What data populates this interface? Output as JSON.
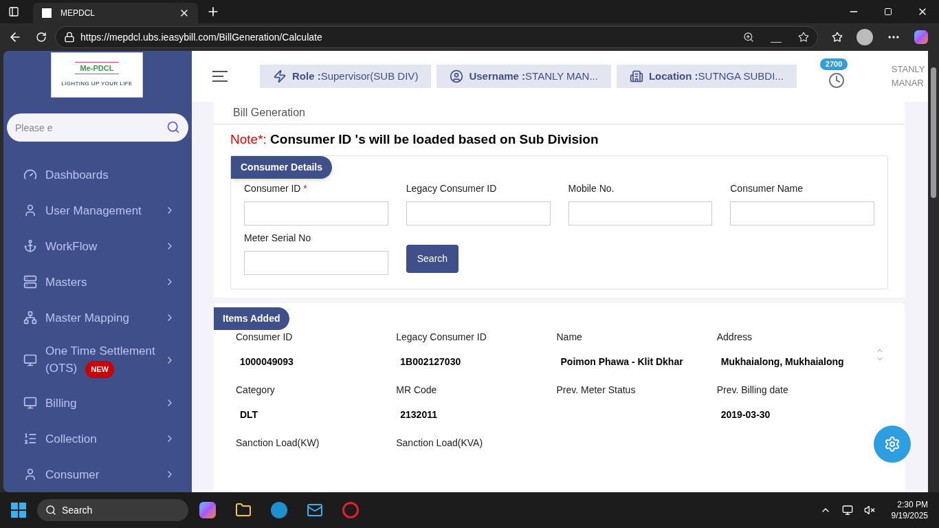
{
  "browser": {
    "tab_title": "MEPDCL",
    "url": "https://mepdcl.ubs.ieasybill.com/BillGeneration/Calculate"
  },
  "logo": {
    "name": "Me-PDCL",
    "tagline": "LIGHTING UP YOUR LIFE"
  },
  "sidebar": {
    "search_placeholder": "Please e",
    "items": [
      {
        "label": "Dashboards",
        "expandable": false
      },
      {
        "label": "User Management",
        "expandable": true
      },
      {
        "label": "WorkFlow",
        "expandable": true
      },
      {
        "label": "Masters",
        "expandable": true
      },
      {
        "label": "Master Mapping",
        "expandable": true
      },
      {
        "label": "One Time Settlement (OTS)",
        "expandable": true,
        "badge": "NEW"
      },
      {
        "label": "Billing",
        "expandable": true
      },
      {
        "label": "Collection",
        "expandable": true
      },
      {
        "label": "Consumer",
        "expandable": true
      }
    ]
  },
  "header": {
    "chips": [
      {
        "label": "Role :",
        "value": "Supervisor(SUB DIV)"
      },
      {
        "label": "Username :",
        "value": "STANLY MAN..."
      },
      {
        "label": "Location :",
        "value": "SUTNGA SUBDI..."
      }
    ],
    "notification_count": "2700",
    "user_name": "STANLY MANAR"
  },
  "page_title": "Bill Generation",
  "note": {
    "prefix": "Note*:",
    "text": "Consumer ID 's will be loaded based on Sub Division"
  },
  "consumer_details": {
    "title": "Consumer Details",
    "fields": [
      {
        "label": "Consumer ID",
        "required_mark": "*"
      },
      {
        "label": "Legacy Consumer ID"
      },
      {
        "label": "Mobile No."
      },
      {
        "label": "Consumer Name"
      },
      {
        "label": "Meter Serial No"
      }
    ],
    "search_button": "Search"
  },
  "items_added": {
    "title": "Items Added",
    "fields": [
      {
        "label": "Consumer ID",
        "value": "1000049093"
      },
      {
        "label": "Legacy Consumer ID",
        "value": "1B002127030"
      },
      {
        "label": "Name",
        "value": "Poimon Phawa - Klit Dkhar"
      },
      {
        "label": "Address",
        "value": "Mukhaialong, Mukhaialong"
      },
      {
        "label": "Category",
        "value": "DLT"
      },
      {
        "label": "MR Code",
        "value": "2132011"
      },
      {
        "label": "Prev. Meter Status"
      },
      {
        "label": "Prev. Billing date",
        "value": "2019-03-30"
      },
      {
        "label": "Sanction Load(KW)"
      },
      {
        "label": "Sanction Load(KVA)"
      }
    ]
  },
  "taskbar": {
    "search": "Search",
    "time": "2:30 PM",
    "date": "9/19/2025"
  }
}
